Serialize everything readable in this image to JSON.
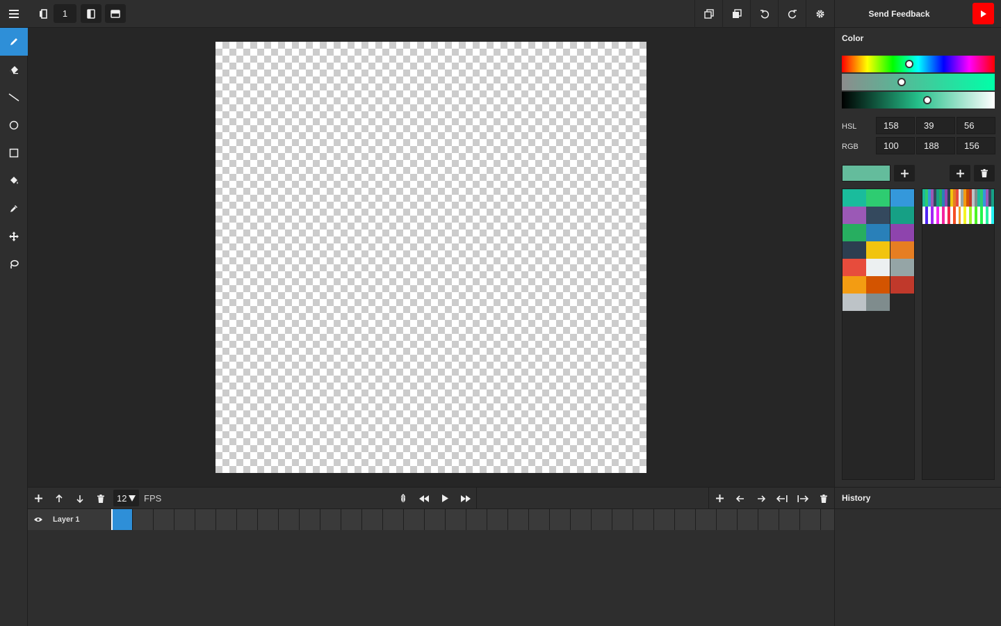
{
  "topbar": {
    "frame_value": "1",
    "icons": [
      "menu-icon",
      "layer-opacity-icon",
      "onion-skin-icon",
      "flip-icon",
      "copy-icon",
      "paste-icon",
      "undo-icon",
      "redo-icon",
      "settings-icon"
    ]
  },
  "feedback": {
    "label": "Send Feedback",
    "accent": "#ff0000"
  },
  "tools": [
    {
      "name": "pencil",
      "active": true
    },
    {
      "name": "eraser",
      "active": false
    },
    {
      "name": "line",
      "active": false
    },
    {
      "name": "ellipse",
      "active": false
    },
    {
      "name": "rectangle",
      "active": false
    },
    {
      "name": "bucket",
      "active": false
    },
    {
      "name": "eyedropper",
      "active": false
    },
    {
      "name": "move",
      "active": false
    },
    {
      "name": "lasso",
      "active": false
    }
  ],
  "color": {
    "title": "Color",
    "hsl_label": "HSL",
    "rgb_label": "RGB",
    "hsl": [
      "158",
      "39",
      "56"
    ],
    "rgb": [
      "100",
      "188",
      "156"
    ],
    "current": "#64bc9c",
    "hue_fraction": 0.44,
    "sat_fraction": 0.39,
    "light_fraction": 0.56
  },
  "palette": {
    "swatches": [
      "#1abc9c",
      "#2ecc71",
      "#3498db",
      "#9b59b6",
      "#34495e",
      "#16a085",
      "#27ae60",
      "#2980b9",
      "#8e44ad",
      "#2c3e50",
      "#f1c40f",
      "#e67e22",
      "#e74c3c",
      "#ecf0f1",
      "#95a5a6",
      "#f39c12",
      "#d35400",
      "#c0392b",
      "#bdc3c7",
      "#7f8c8d"
    ]
  },
  "timeline": {
    "fps_value": "12",
    "fps_label": "FPS",
    "layer_name": "Layer 1",
    "frame_count": 35,
    "active_frame": 0
  },
  "history": {
    "title": "History"
  }
}
